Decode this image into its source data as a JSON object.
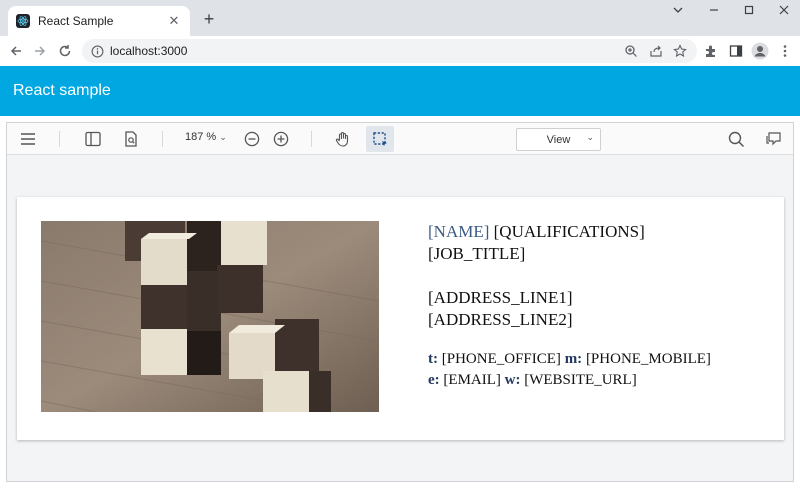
{
  "browser": {
    "tab_title": "React Sample",
    "url": "localhost:3000"
  },
  "app": {
    "header_title": "React sample"
  },
  "viewer_toolbar": {
    "zoom": "187 %",
    "view_label": "View"
  },
  "document": {
    "name": "[NAME]",
    "qualifications": "[QUALIFICATIONS]",
    "job_title": "[JOB_TITLE]",
    "address_line1": "[ADDRESS_LINE1]",
    "address_line2": "[ADDRESS_LINE2]",
    "phone_office_label": "t:",
    "phone_office": "[PHONE_OFFICE]",
    "phone_mobile_label": "m:",
    "phone_mobile": "[PHONE_MOBILE]",
    "email_label": "e:",
    "email": "[EMAIL]",
    "website_label": "w:",
    "website": "[WEBSITE_URL]"
  },
  "colors": {
    "header": "#00a7e1",
    "name_text": "#3c5a84",
    "label_text": "#22375e"
  },
  "icons": [
    "react-icon",
    "close-icon",
    "plus-icon",
    "back-icon",
    "forward-icon",
    "reload-icon",
    "info-icon",
    "zoom-icon",
    "share-icon",
    "star-icon",
    "extension-icon",
    "sidepanel-icon",
    "profile-icon",
    "menu-icon",
    "hamburger-icon",
    "thumbnails-icon",
    "page-search-icon",
    "zoom-out-icon",
    "zoom-in-icon",
    "hand-tool-icon",
    "selection-tool-icon",
    "search-icon",
    "comments-icon"
  ]
}
